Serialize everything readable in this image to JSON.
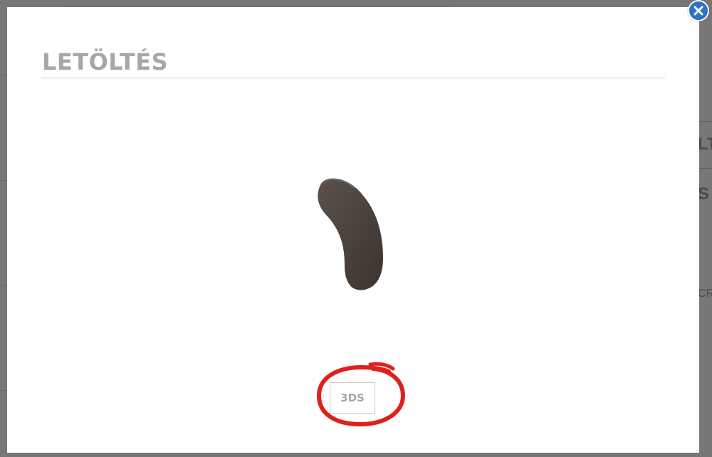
{
  "modal": {
    "title": "LETÖLTÉS",
    "download_format": "3DS",
    "close_icon": "close-icon",
    "colors": {
      "title": "#a7a7ab",
      "close_button": "#2a73c6",
      "highlight_circle": "#e0201c",
      "product": "#4d4540"
    }
  },
  "background": {
    "fragment_1": "LT",
    "fragment_2": "S A",
    "fragment_3": "CR"
  }
}
